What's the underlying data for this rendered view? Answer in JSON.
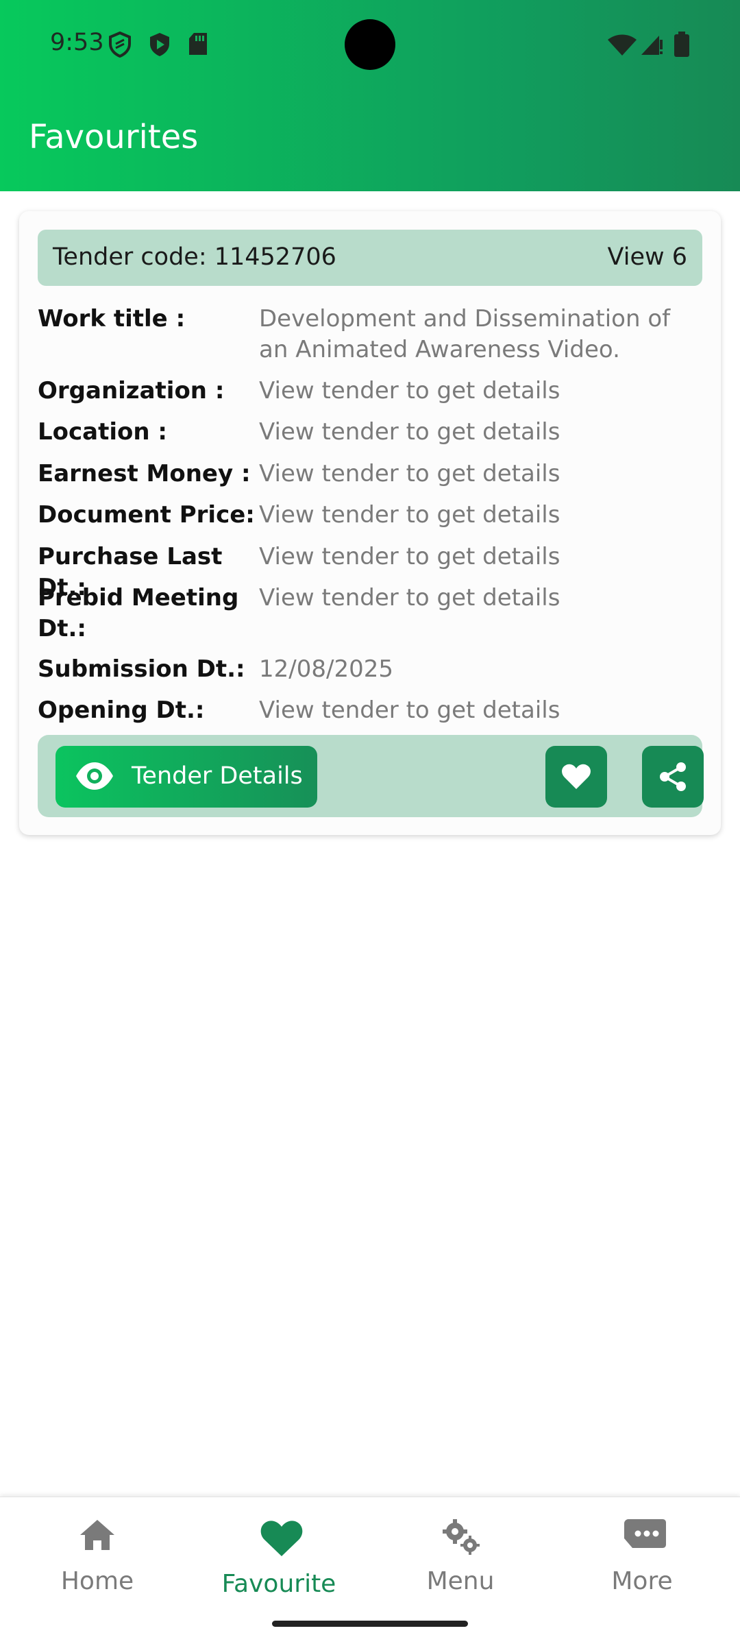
{
  "status_bar": {
    "time": "9:53",
    "left_icons": [
      "shield-outline-icon",
      "shield-play-icon",
      "sd-card-icon"
    ],
    "right_icons": [
      "wifi-icon",
      "cellular-signal-icon",
      "battery-icon"
    ]
  },
  "header": {
    "title": "Favourites",
    "gradient": [
      "#07c95c",
      "#178a55"
    ]
  },
  "tender_card": {
    "code_text": "Tender code: 11452706",
    "views_text": "View 6",
    "fields": [
      {
        "label": "Work title :",
        "value": "Development and Dissemination of an Animated Awareness Video."
      },
      {
        "label": "Organization :",
        "value": "View tender to get details"
      },
      {
        "label": "Location :",
        "value": "View tender to get details"
      },
      {
        "label": "Earnest Money :",
        "value": "View tender to get details"
      },
      {
        "label": "Document Price:",
        "value": "View tender to get details"
      },
      {
        "label": "Purchase Last Dt.:",
        "value": "View tender to get details"
      },
      {
        "label": "Prebid Meeting Dt.:",
        "value": "View tender to get details"
      },
      {
        "label": "Submission Dt.:",
        "value": "12/08/2025"
      },
      {
        "label": "Opening Dt.:",
        "value": "View tender to get details"
      }
    ],
    "details_button": "Tender Details",
    "favourite_icon": "heart-icon",
    "share_icon": "share-icon"
  },
  "bottom_nav": {
    "items": [
      {
        "label": "Home",
        "icon": "home-icon",
        "active": false
      },
      {
        "label": "Favourite",
        "icon": "heart-icon",
        "active": true
      },
      {
        "label": "Menu",
        "icon": "gears-icon",
        "active": false
      },
      {
        "label": "More",
        "icon": "message-dots-icon",
        "active": false
      }
    ],
    "active_color": "#178a55",
    "inactive_color": "#7a7a7a"
  }
}
